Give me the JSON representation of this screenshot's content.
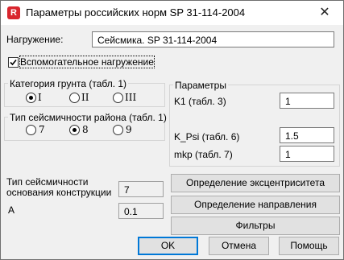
{
  "window": {
    "title": "Параметры российских норм SP 31-114-2004",
    "app_icon_letter": "R",
    "close_glyph": "✕"
  },
  "load": {
    "label": "Нагружение:",
    "value": "Сейсмика. SP 31-114-2004"
  },
  "auxiliary_load": {
    "label": "Вспомогательное нагружение",
    "checked": true
  },
  "soil_category": {
    "title": "Категория грунта (табл. 1)",
    "options": [
      "I",
      "II",
      "III"
    ],
    "selected_index": 0
  },
  "seismicity": {
    "title": "Тип сейсмичности района (табл. 1)",
    "options": [
      "7",
      "8",
      "9"
    ],
    "selected_index": 1
  },
  "parameters": {
    "title": "Параметры",
    "k1_label": "K1 (табл. 3)",
    "k1_value": "1",
    "kpsi_label": "K_Psi (табл. 6)",
    "kpsi_value": "1.5",
    "mkp_label": "mkp (табл. 7)",
    "mkp_value": "1"
  },
  "foundation": {
    "label_line1": "Тип сейсмичности",
    "label_line2": "основания конструкции",
    "value": "7",
    "a_label": "A",
    "a_value": "0.1"
  },
  "buttons": {
    "eccentricity": "Определение эксцентриситета",
    "direction": "Определение направления",
    "filters": "Фильтры",
    "ok": "OK",
    "cancel": "Отмена",
    "help": "Помощь"
  }
}
